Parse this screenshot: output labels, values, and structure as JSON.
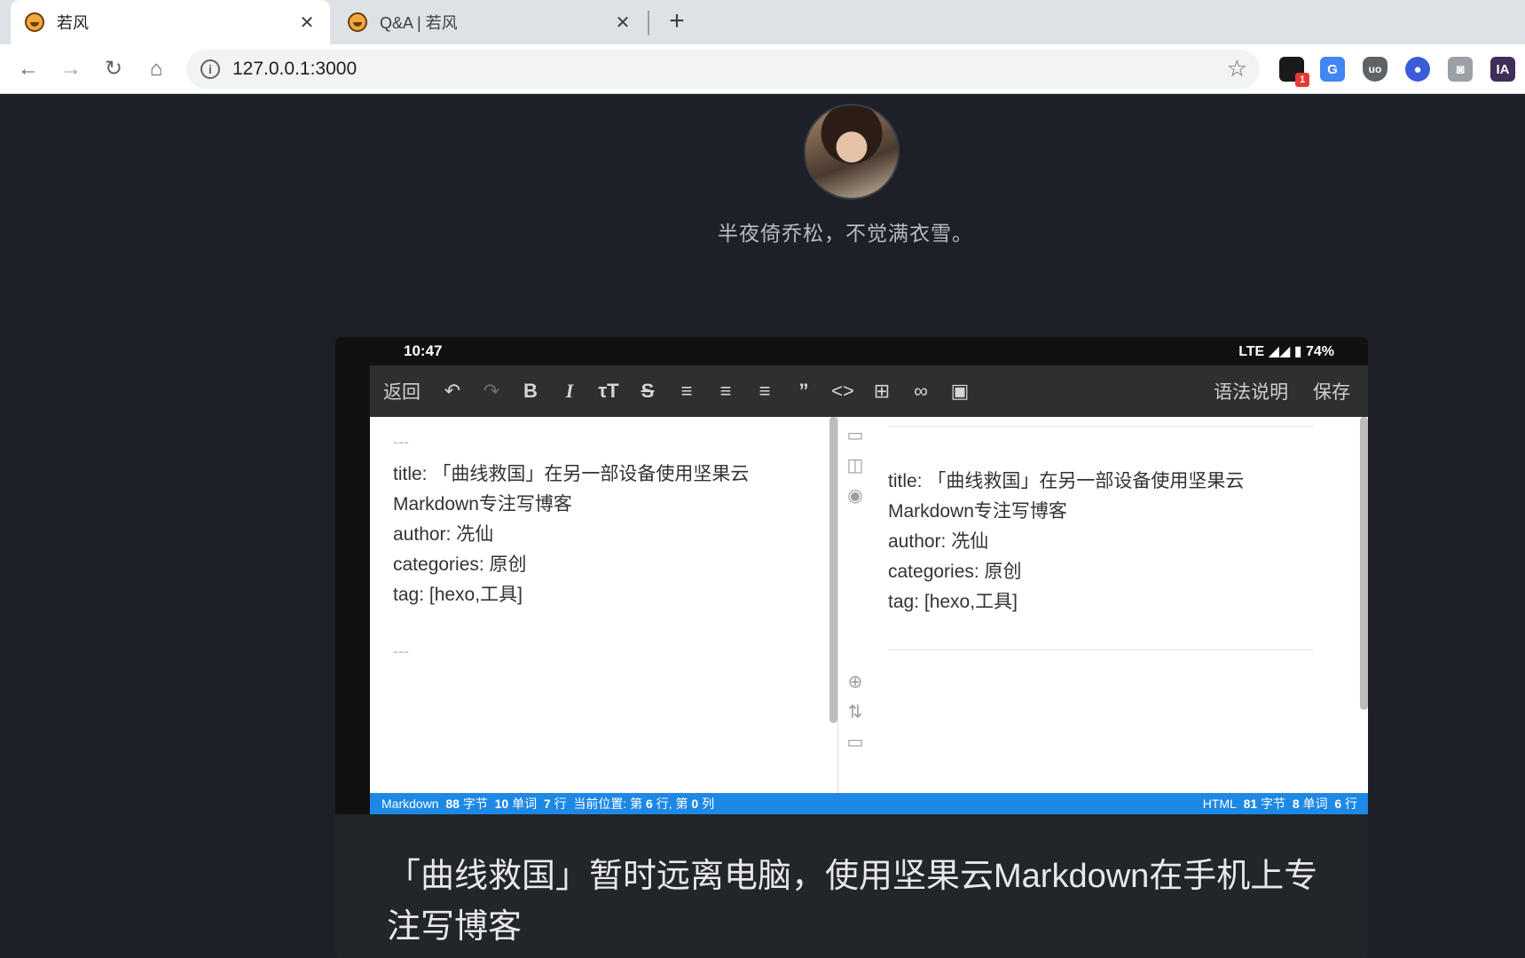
{
  "browser": {
    "tabs": [
      {
        "title": "若风",
        "active": true
      },
      {
        "title": "Q&A | 若风",
        "active": false
      }
    ],
    "close_glyph": "✕",
    "new_tab_glyph": "+",
    "url": "127.0.0.1:3000",
    "extensions": [
      {
        "name": "notification-extension-icon",
        "label": "",
        "badge": "1",
        "color": "#1a1a1a"
      },
      {
        "name": "translate-extension-icon",
        "label": "G",
        "color": "#4285f4"
      },
      {
        "name": "ublock-extension-icon",
        "label": "uo",
        "color": "#5f6368"
      },
      {
        "name": "github-extension-icon",
        "label": "●",
        "color": "#3b5bdb"
      },
      {
        "name": "camera-extension-icon",
        "label": "◙",
        "color": "#9aa0a6"
      },
      {
        "name": "ia-extension-icon",
        "label": "IA",
        "color": "#3f2d5a"
      }
    ]
  },
  "page": {
    "motto": "半夜倚乔松，不觉满衣雪。",
    "headline": "「曲线救国」暂时远离电脑，使用坚果云Markdown在手机上专注写博客"
  },
  "phone": {
    "time": "10:47",
    "status_right": "LTE ◢◢ ▮ 74%",
    "toolbar": {
      "back": "返回",
      "syntax": "语法说明",
      "save": "保存"
    },
    "markdown_lines": [
      "---",
      "title: 「曲线救国」在另一部设备使用坚果云",
      "Markdown专注写博客",
      "author: 冼仙",
      "categories: 原创",
      "tag: [hexo,工具]",
      "---"
    ],
    "preview_lines": [
      "title: 「曲线救国」在另一部设备使用坚果云",
      "Markdown专注写博客",
      "author: 冼仙",
      "categories: 原创",
      "tag: [hexo,工具]"
    ],
    "footer_left": {
      "mode": "Markdown",
      "bytes": "88",
      "bytes_unit": "字节",
      "words": "10",
      "words_unit": "单词",
      "lines": "7",
      "lines_unit": "行",
      "position_label": "当前位置: 第",
      "row": "6",
      "row_unit": "行, 第",
      "col": "0",
      "col_unit": "列"
    },
    "footer_right": {
      "mode": "HTML",
      "bytes": "81",
      "bytes_unit": "字节",
      "words": "8",
      "words_unit": "单词",
      "lines": "6",
      "lines_unit": "行"
    }
  }
}
